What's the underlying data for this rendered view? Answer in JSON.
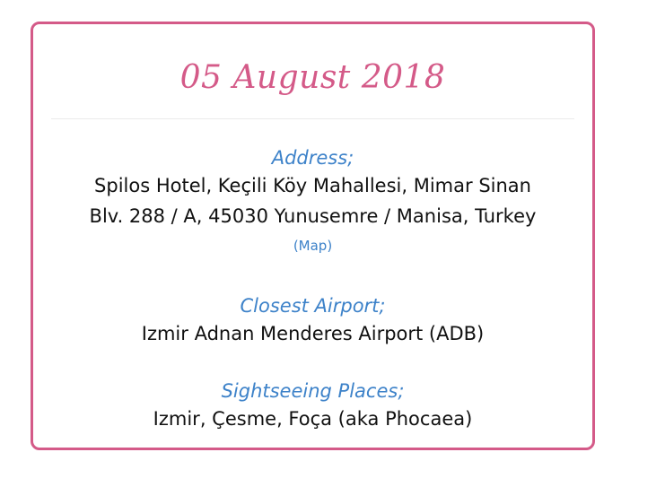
{
  "event": {
    "date": "05 August 2018"
  },
  "address": {
    "label": "Address;",
    "line1": "Spilos Hotel, Keçili Köy Mahallesi, Mimar Sinan",
    "line2": "Blv. 288 / A, 45030 Yunusemre / Manisa, Turkey",
    "map_link": "(Map)"
  },
  "airport": {
    "label": "Closest Airport;",
    "value": "Izmir Adnan Menderes Airport (ADB)"
  },
  "sightseeing": {
    "label": "Sightseeing Places;",
    "value": "Izmir, Çesme, Foça (aka Phocaea)"
  },
  "colors": {
    "accent_pink": "#d45a88",
    "label_blue": "#3d82c9",
    "text": "#111111"
  }
}
